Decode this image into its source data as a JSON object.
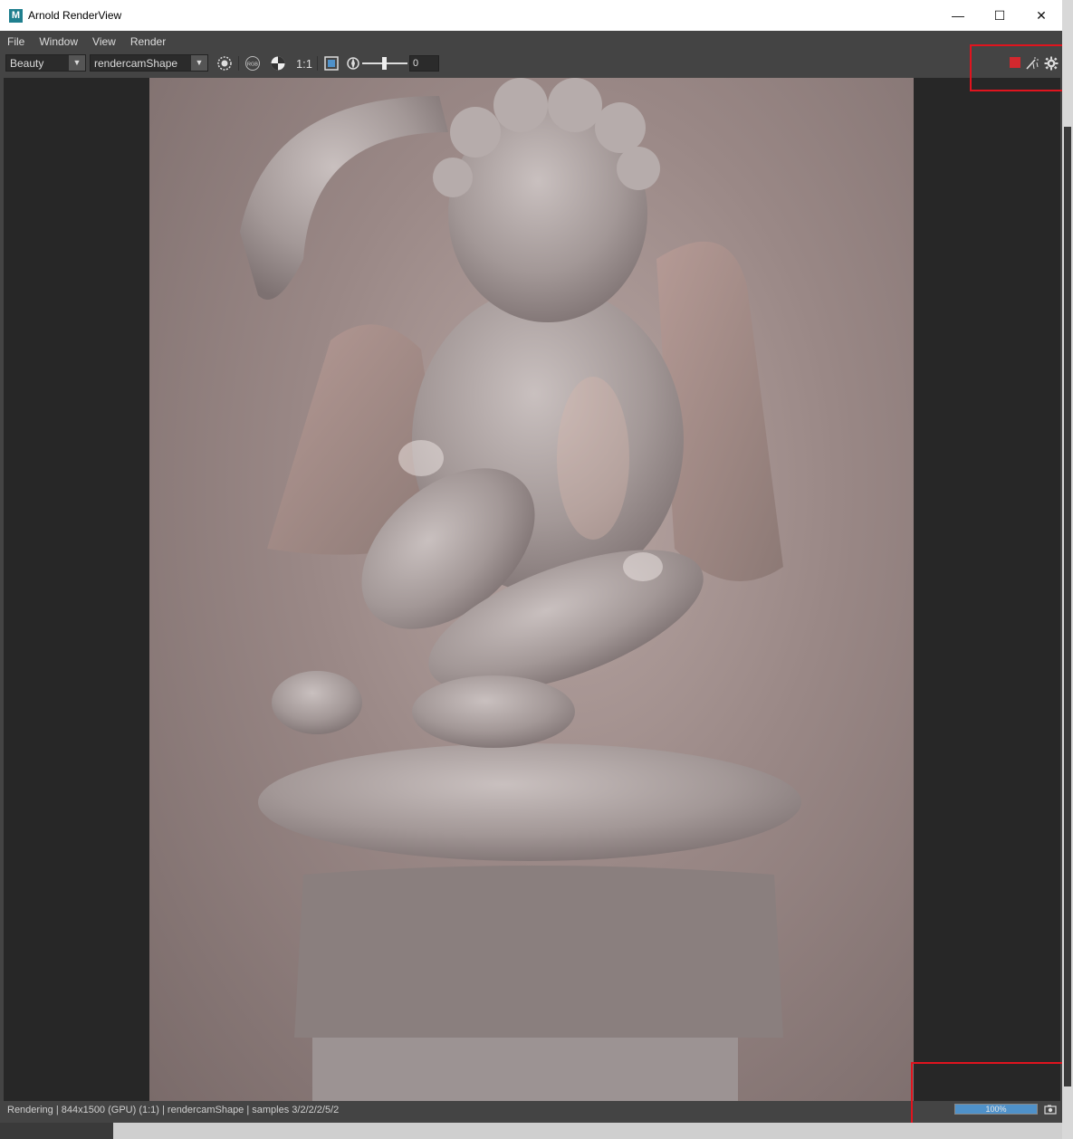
{
  "window": {
    "title": "Arnold RenderView",
    "app_icon": "M"
  },
  "window_controls": {
    "minimize": "—",
    "maximize": "☐",
    "close": "✕"
  },
  "menu": [
    "File",
    "Window",
    "View",
    "Render"
  ],
  "toolbar": {
    "aov": "Beauty",
    "camera": "rendercamShape",
    "ratio": "1:1",
    "rgb": "RGB",
    "exposure_value": "0"
  },
  "status": {
    "text": "Rendering | 844x1500 (GPU) (1:1) | rendercamShape | samples 3/2/2/2/5/2",
    "progress_label": "100%",
    "progress": 1.0
  },
  "colors": {
    "stop": "#d3282e",
    "highlight": "#e0141e",
    "progress": "#4f91c9"
  },
  "icons": [
    "maya-icon",
    "minimize-icon",
    "maximize-icon",
    "close-icon",
    "dropdown-arrow-icon",
    "crosshair-icon",
    "rgb-icon",
    "checker-icon",
    "frame-region-icon",
    "exposure-icon",
    "stop-icon",
    "magic-wand-icon",
    "gear-icon",
    "snapshot-icon"
  ]
}
